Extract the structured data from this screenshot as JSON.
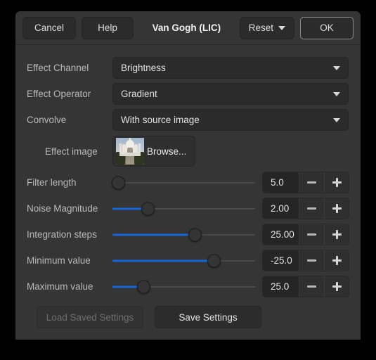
{
  "header": {
    "cancel_label": "Cancel",
    "help_label": "Help",
    "title": "Van Gogh (LIC)",
    "reset_label": "Reset",
    "reset_icon": "chevron-down-icon",
    "ok_label": "OK"
  },
  "combos": [
    {
      "label": "Effect Channel",
      "value": "Brightness",
      "icon": "chevron-down-icon"
    },
    {
      "label": "Effect Operator",
      "value": "Gradient",
      "icon": "chevron-down-icon"
    },
    {
      "label": "Convolve",
      "value": "With source image",
      "icon": "chevron-down-icon"
    }
  ],
  "effect_image": {
    "label": "Effect image",
    "browse_label": "Browse...",
    "thumbnail_name": "taj-mahal-thumbnail"
  },
  "sliders": [
    {
      "label": "Filter length",
      "value": "5.0",
      "fill_percent": 4,
      "minus_label": "minus-icon",
      "plus_label": "plus-icon"
    },
    {
      "label": "Noise Magnitude",
      "value": "2.00",
      "fill_percent": 25,
      "minus_label": "minus-icon",
      "plus_label": "plus-icon"
    },
    {
      "label": "Integration steps",
      "value": "25.00",
      "fill_percent": 58,
      "minus_label": "minus-icon",
      "plus_label": "plus-icon"
    },
    {
      "label": "Minimum value",
      "value": "-25.0",
      "fill_percent": 71,
      "minus_label": "minus-icon",
      "plus_label": "plus-icon"
    },
    {
      "label": "Maximum value",
      "value": "25.0",
      "fill_percent": 22,
      "minus_label": "minus-icon",
      "plus_label": "plus-icon"
    }
  ],
  "footer": {
    "load_label": "Load Saved Settings",
    "load_enabled": false,
    "save_label": "Save Settings",
    "save_enabled": true
  },
  "colors": {
    "dialog_bg": "#353535",
    "control_bg": "#2b2b2b",
    "field_bg": "#252525",
    "accent": "#1565d8",
    "text": "#e2e2e2",
    "label_text": "#b9b9b9",
    "disabled_text": "#6f6f6f",
    "page_bg": "#000000"
  }
}
